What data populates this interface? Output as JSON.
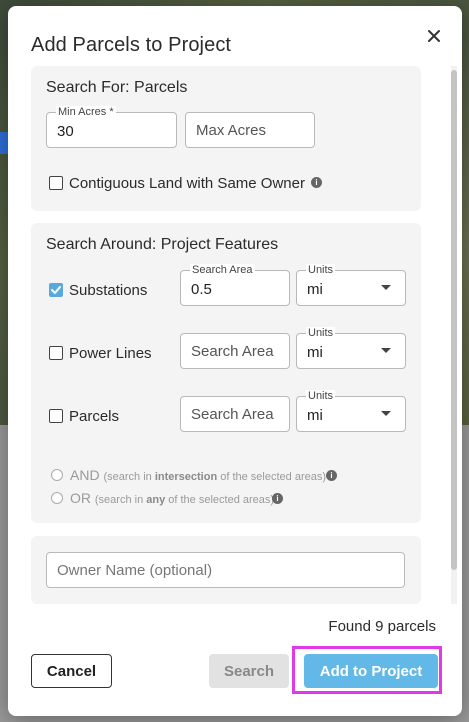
{
  "modal": {
    "title": "Add Parcels to Project",
    "close_icon": "close-icon"
  },
  "search_for": {
    "title": "Search For: Parcels",
    "min_acres_label": "Min Acres *",
    "min_acres_value": "30",
    "max_acres_placeholder": "Max Acres",
    "contiguous_label": "Contiguous Land with Same Owner",
    "contiguous_checked": false
  },
  "search_around": {
    "title": "Search Around: Project Features",
    "features": [
      {
        "label": "Substations",
        "checked": true,
        "area_label": "Search Area",
        "area_value": "0.5",
        "units_label": "Units",
        "units_value": "mi"
      },
      {
        "label": "Power Lines",
        "checked": false,
        "area_placeholder": "Search Area",
        "units_label": "Units",
        "units_value": "mi"
      },
      {
        "label": "Parcels",
        "checked": false,
        "area_placeholder": "Search Area",
        "units_label": "Units",
        "units_value": "mi"
      }
    ],
    "logic": [
      {
        "main": "AND",
        "pre": "(search in ",
        "bold": "intersection",
        "post": " of the selected areas)"
      },
      {
        "main": "OR",
        "pre": "(search in ",
        "bold": "any",
        "post": " of the selected areas)"
      }
    ]
  },
  "owner": {
    "placeholder": "Owner Name (optional)"
  },
  "status": {
    "found": "Found 9 parcels"
  },
  "buttons": {
    "cancel": "Cancel",
    "search": "Search",
    "add": "Add to Project"
  },
  "colors": {
    "accent": "#62b8e7",
    "checkbox_checked": "#5aa9dc",
    "highlight": "#e03ae8"
  }
}
